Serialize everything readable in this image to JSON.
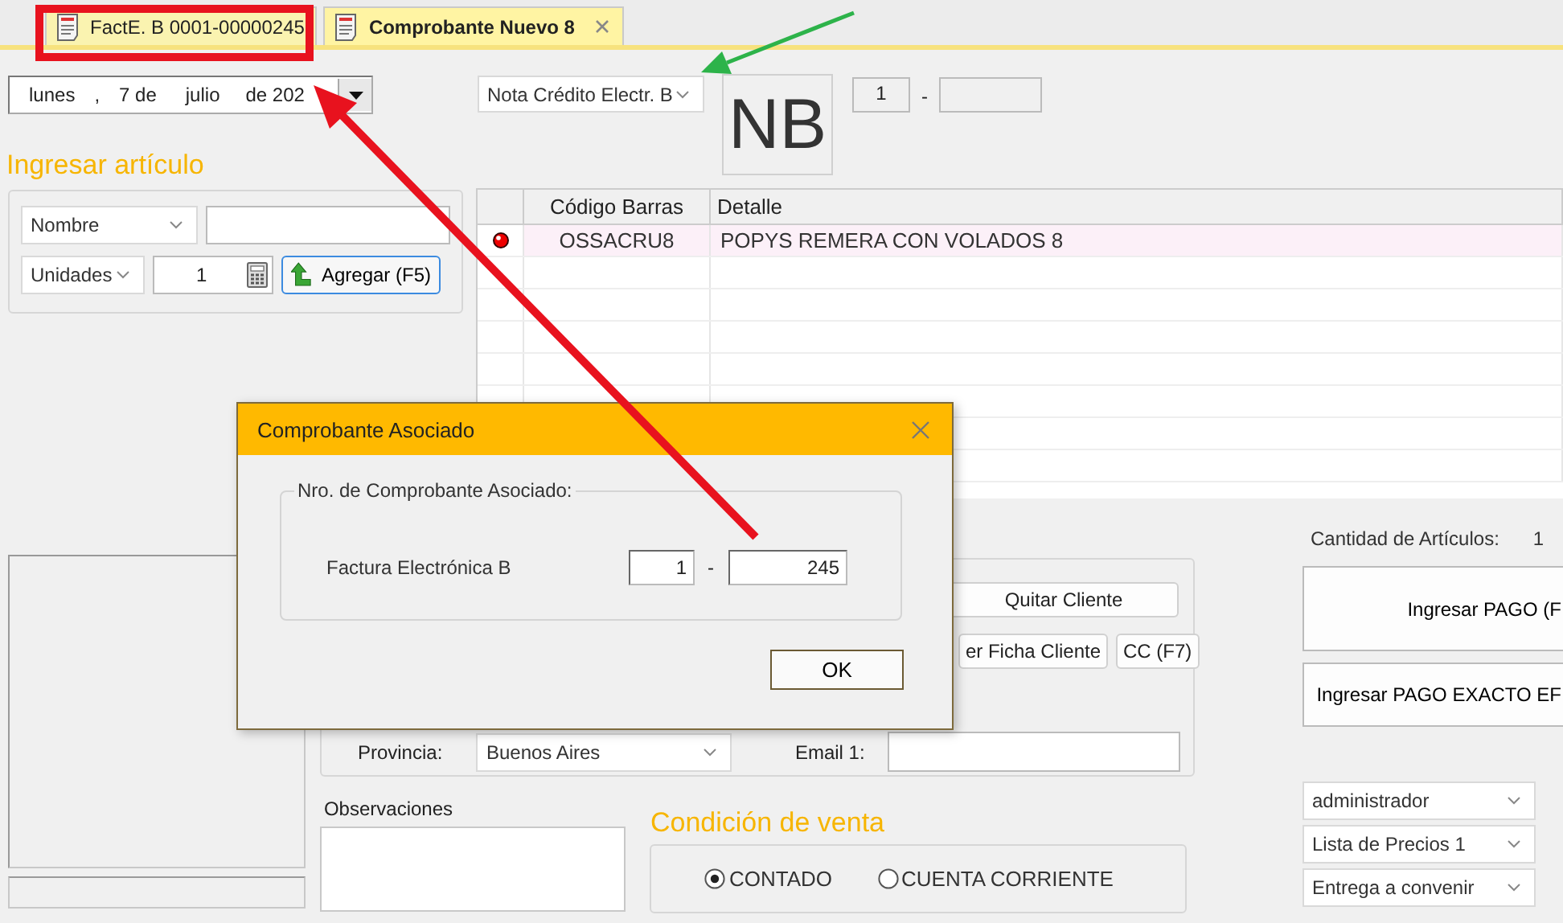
{
  "tabs": [
    {
      "label": "FactE. B 0001-00000245",
      "selected": false,
      "closable": false
    },
    {
      "label": "Comprobante Nuevo 8",
      "selected": true,
      "closable": true
    }
  ],
  "date_picker": {
    "weekday": "lunes",
    "separator": ",",
    "day": "7 de",
    "month": "julio",
    "year": "de 202"
  },
  "doc_type": {
    "value": "Nota Crédito Electr. B"
  },
  "letter": "NB",
  "number": {
    "point": "1",
    "separator": "-"
  },
  "add_article": {
    "title": "Ingresar artículo",
    "search_by": "Nombre",
    "unit": "Unidades",
    "quantity": "1",
    "add_button": "Agregar (F5)"
  },
  "table": {
    "columns": [
      "Código Barras",
      "Detalle"
    ],
    "rows": [
      {
        "barcode": "OSSACRU8",
        "detail": "POPYS REMERA CON VOLADOS 8",
        "selected": true
      }
    ]
  },
  "client": {
    "remove_button": "Quitar Cliente",
    "view_button": "er Ficha Cliente",
    "account_button": "CC (F7)",
    "province_label": "Provincia:",
    "province": "Buenos Aires",
    "email_label": "Email 1:"
  },
  "notes": {
    "label": "Observaciones"
  },
  "sale_condition": {
    "title": "Condición de venta",
    "options": [
      {
        "label": "CONTADO",
        "selected": true
      },
      {
        "label": "CUENTA CORRIENTE",
        "selected": false
      }
    ]
  },
  "summary": {
    "count_label": "Cantidad de Artículos:",
    "count": "1",
    "pay_button": "Ingresar PAGO (F",
    "exact_pay_button": "Ingresar PAGO EXACTO EF",
    "selects": [
      "administrador",
      "Lista de Precios 1",
      "Entrega a convenir"
    ]
  },
  "dialog": {
    "title": "Comprobante Asociado",
    "group_label": "Nro. de Comprobante Asociado:",
    "doc_label": "Factura Electrónica B",
    "point": "1",
    "separator": "-",
    "number": "245",
    "ok_button": "OK"
  }
}
